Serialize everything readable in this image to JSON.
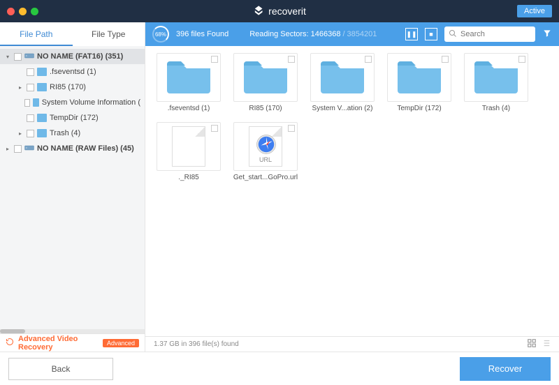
{
  "title": "recoverit",
  "active_badge": "Active",
  "tabs": {
    "file_path": "File Path",
    "file_type": "File Type"
  },
  "tree": [
    {
      "label": "NO NAME (FAT16) (351)",
      "type": "drive",
      "expanded": true,
      "level": 0,
      "selected": true
    },
    {
      "label": ".fseventsd (1)",
      "type": "folder",
      "level": 1
    },
    {
      "label": "RI85 (170)",
      "type": "folder",
      "level": 1,
      "hasChildren": true
    },
    {
      "label": "System Volume Information (",
      "type": "folder",
      "level": 1
    },
    {
      "label": "TempDir (172)",
      "type": "folder",
      "level": 1
    },
    {
      "label": "Trash (4)",
      "type": "folder",
      "level": 1,
      "hasChildren": true
    },
    {
      "label": "NO NAME (RAW Files) (45)",
      "type": "drive",
      "level": 0,
      "hasChildren": true
    }
  ],
  "advanced": {
    "label": "Advanced Video Recovery",
    "badge": "Advanced"
  },
  "toolbar": {
    "percent": "68%",
    "files_found": "396 files Found",
    "sectors_label": "Reading Sectors:",
    "sectors_current": "1466368",
    "sectors_sep": "/",
    "sectors_total": "3854201",
    "search_placeholder": "Search"
  },
  "grid": [
    {
      "kind": "folder",
      "label": ".fseventsd (1)"
    },
    {
      "kind": "folder",
      "label": "RI85 (170)"
    },
    {
      "kind": "folder",
      "label": "System V...ation (2)"
    },
    {
      "kind": "folder",
      "label": "TempDir (172)"
    },
    {
      "kind": "folder",
      "label": "Trash (4)"
    },
    {
      "kind": "file",
      "label": "._RI85"
    },
    {
      "kind": "url",
      "label": "Get_start...GoPro.url",
      "url_text": "URL"
    }
  ],
  "status": "1.37 GB in 396 file(s) found",
  "footer": {
    "back": "Back",
    "recover": "Recover"
  }
}
